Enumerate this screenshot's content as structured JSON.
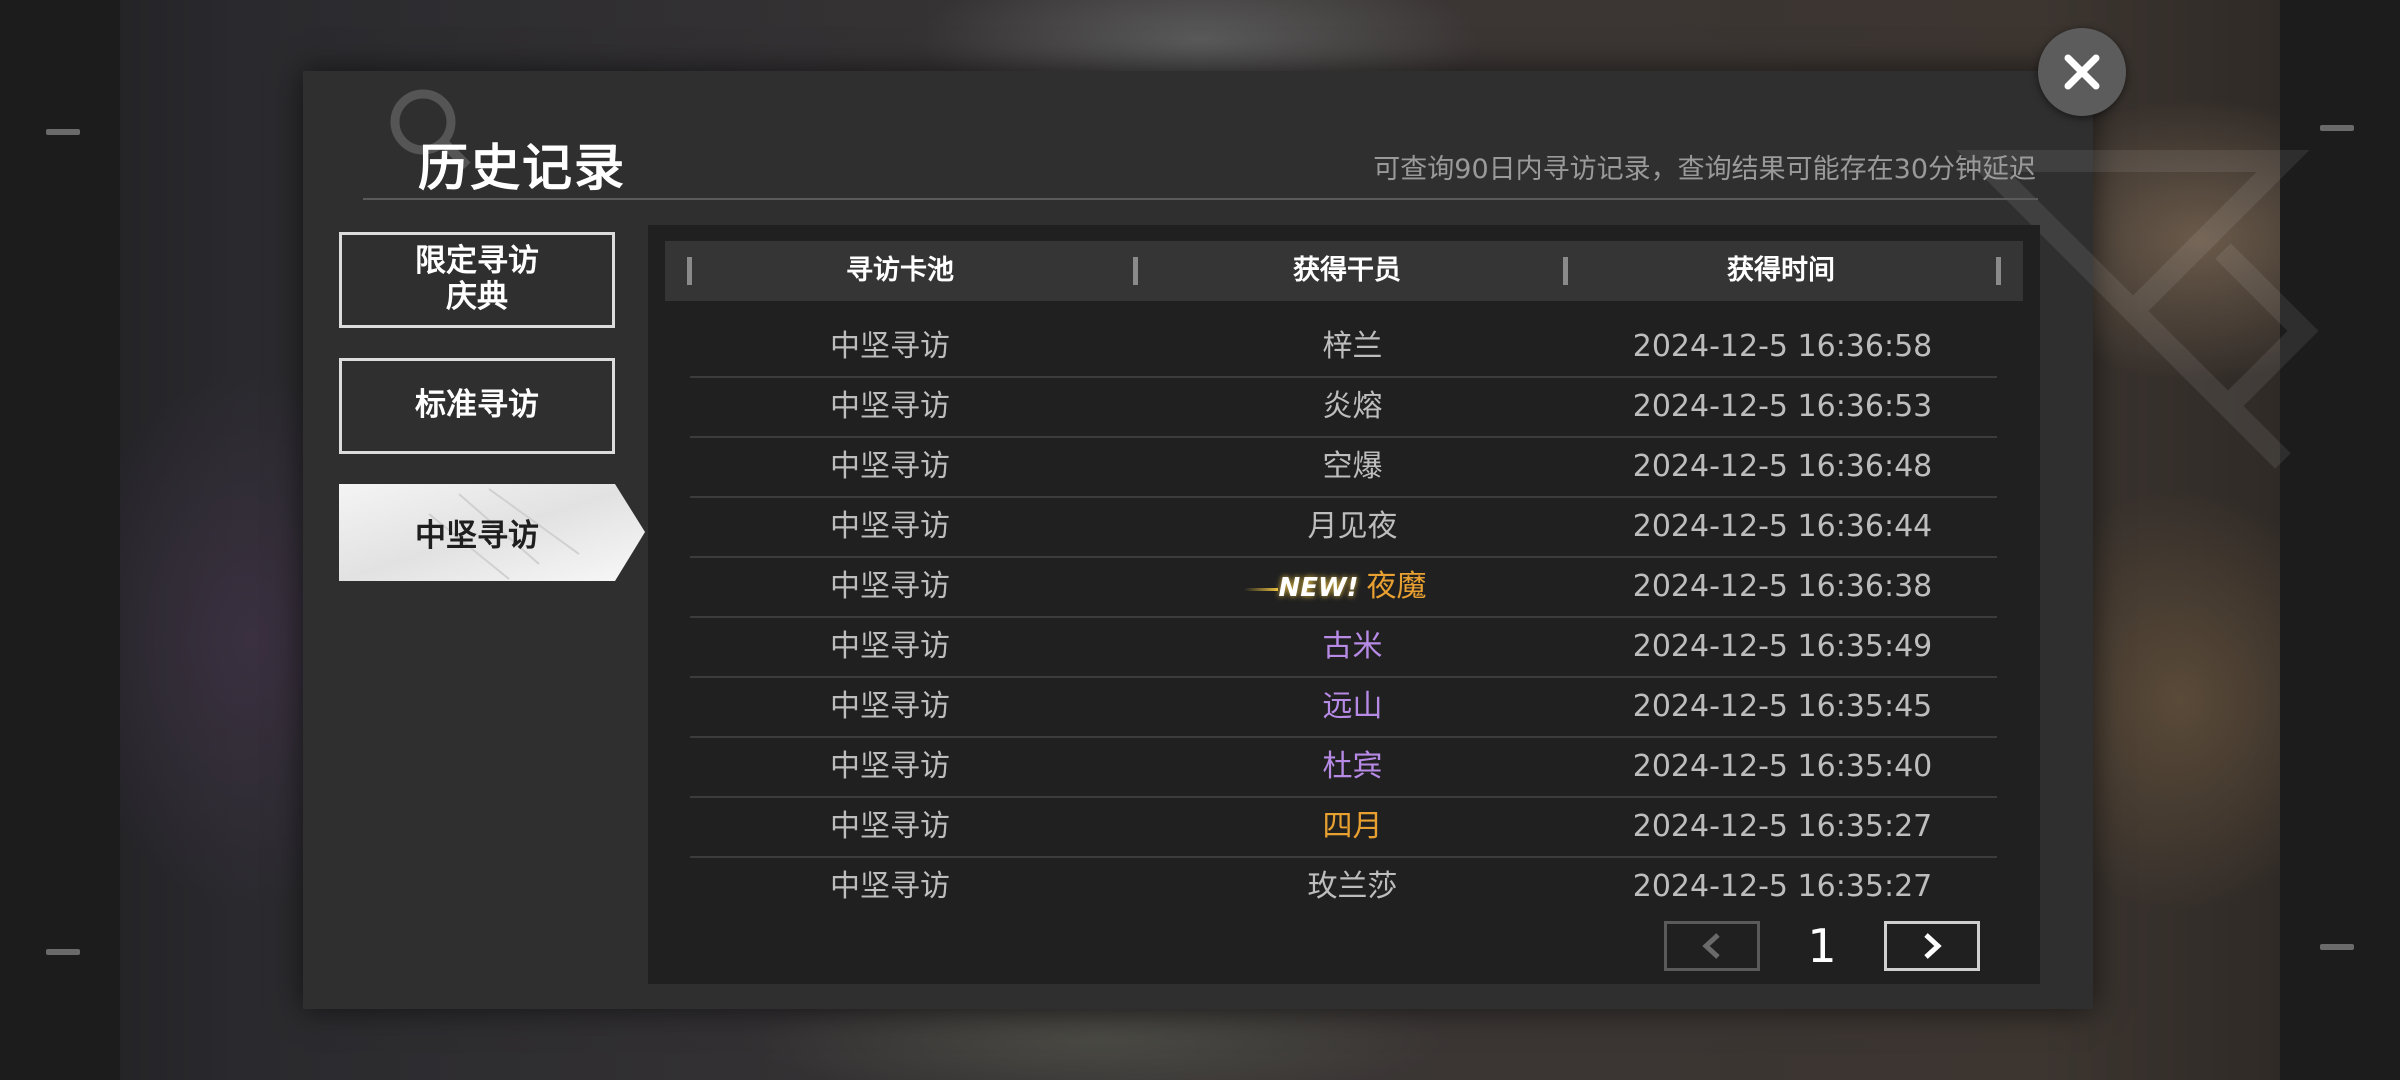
{
  "header": {
    "title": "历史记录",
    "subtitle": "可查询90日内寻访记录，查询结果可能存在30分钟延迟"
  },
  "tabs": [
    {
      "label": "限定寻访\n庆典",
      "line1": "限定寻访",
      "line2": "庆典",
      "active": false
    },
    {
      "label": "标准寻访",
      "active": false
    },
    {
      "label": "中坚寻访",
      "active": true
    }
  ],
  "table": {
    "headers": [
      "寻访卡池",
      "获得干员",
      "获得时间"
    ],
    "rows": [
      {
        "pool": "中坚寻访",
        "operator": "梓兰",
        "time": "2024-12-5 16:36:58",
        "color": "#bdbdbd",
        "is_new": false
      },
      {
        "pool": "中坚寻访",
        "operator": "炎熔",
        "time": "2024-12-5 16:36:53",
        "color": "#bdbdbd",
        "is_new": false
      },
      {
        "pool": "中坚寻访",
        "operator": "空爆",
        "time": "2024-12-5 16:36:48",
        "color": "#bdbdbd",
        "is_new": false
      },
      {
        "pool": "中坚寻访",
        "operator": "月见夜",
        "time": "2024-12-5 16:36:44",
        "color": "#bdbdbd",
        "is_new": false
      },
      {
        "pool": "中坚寻访",
        "operator": "夜魔",
        "time": "2024-12-5 16:36:38",
        "color": "#e8a030",
        "is_new": true,
        "new_label": "NEW!"
      },
      {
        "pool": "中坚寻访",
        "operator": "古米",
        "time": "2024-12-5 16:35:49",
        "color": "#b78ae6",
        "is_new": false
      },
      {
        "pool": "中坚寻访",
        "operator": "远山",
        "time": "2024-12-5 16:35:45",
        "color": "#b78ae6",
        "is_new": false
      },
      {
        "pool": "中坚寻访",
        "operator": "杜宾",
        "time": "2024-12-5 16:35:40",
        "color": "#b78ae6",
        "is_new": false
      },
      {
        "pool": "中坚寻访",
        "operator": "四月",
        "time": "2024-12-5 16:35:27",
        "color": "#e8a030",
        "is_new": false
      },
      {
        "pool": "中坚寻访",
        "operator": "玫兰莎",
        "time": "2024-12-5 16:35:27",
        "color": "#bdbdbd",
        "is_new": false
      }
    ]
  },
  "pagination": {
    "current_page": "1",
    "prev_icon": "chevron-left-icon",
    "next_icon": "chevron-right-icon"
  },
  "icons": {
    "close": "close-icon",
    "search_deco": "search-icon"
  },
  "colors": {
    "rarity_6": "#e8a030",
    "rarity_4": "#b78ae6",
    "default_text": "#bdbdbd"
  }
}
